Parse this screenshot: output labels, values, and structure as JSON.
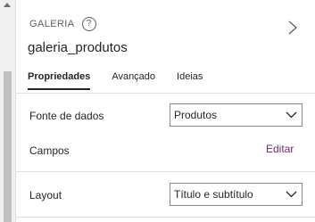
{
  "header": {
    "control_type": "GALERIA",
    "control_name": "galeria_produtos",
    "help_icon": "help-circle-icon",
    "expand_icon": "chevron-right-icon"
  },
  "tabs": [
    {
      "label": "Propriedades",
      "active": true
    },
    {
      "label": "Avançado",
      "active": false
    },
    {
      "label": "Ideias",
      "active": false
    }
  ],
  "properties": {
    "data_source": {
      "label": "Fonte de dados",
      "value": "Produtos"
    },
    "fields": {
      "label": "Campos",
      "action": "Editar"
    },
    "layout": {
      "label": "Layout",
      "value": "Título e subtítulo"
    }
  },
  "colors": {
    "accent_link": "#742774",
    "text": "#252423",
    "divider": "#e1dfdd"
  }
}
